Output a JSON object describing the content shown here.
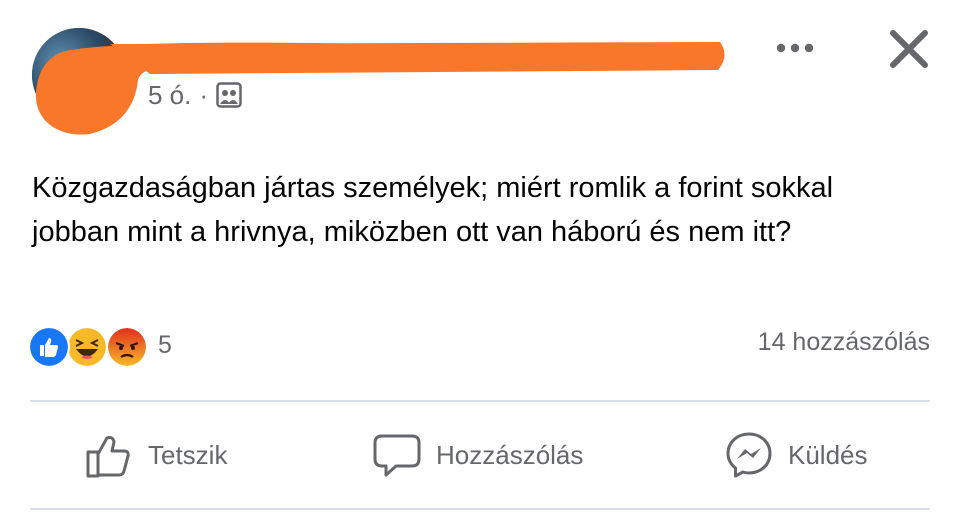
{
  "post": {
    "author_name": "",
    "timestamp": "5 ó.",
    "separator": "·",
    "audience_icon": "group-audience-icon",
    "text": "Közgazdaságban jártas személyek; miért romlik a forint sokkal jobban mint a hrivnya, miközben ott van háború és nem itt?",
    "redaction_color": "#f8772a"
  },
  "header": {
    "more_icon": "more-horizontal-icon",
    "close_icon": "close-icon"
  },
  "engagement": {
    "reactions": [
      "like",
      "haha",
      "angry"
    ],
    "reaction_count": "5",
    "comment_count": "14 hozzászólás"
  },
  "actions": {
    "like_label": "Tetszik",
    "comment_label": "Hozzászólás",
    "share_label": "Küldés"
  },
  "colors": {
    "like_blue": "#1877f2",
    "haha_yellow": "#f7b928",
    "angry_orange": "#e9710f",
    "secondary_text": "#65676b"
  }
}
